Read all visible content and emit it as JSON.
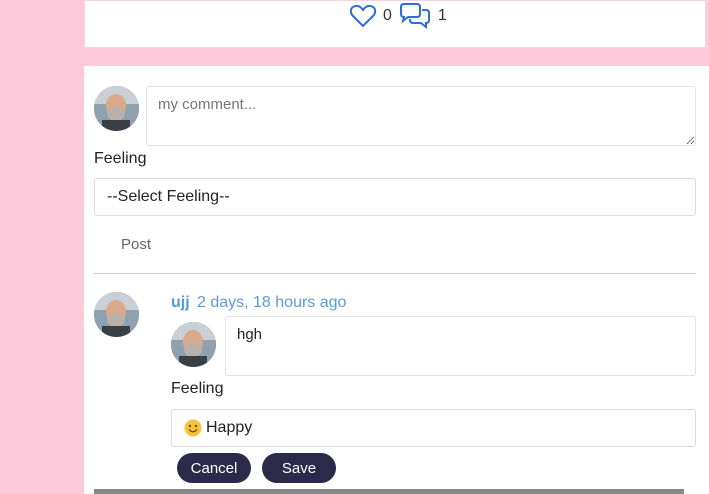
{
  "stats": {
    "likes": "0",
    "comments": "1"
  },
  "composer": {
    "placeholder": "my comment...",
    "feeling_label": "Feeling",
    "feeling_select": "--Select Feeling--",
    "post_label": "Post"
  },
  "comment": {
    "username": "ujj",
    "timestamp": "2 days, 18 hours ago",
    "reply_text": "hgh",
    "feeling_label": "Feeling",
    "feeling_value": "Happy",
    "cancel_label": "Cancel",
    "save_label": "Save"
  },
  "colors": {
    "background": "#ffc9dc",
    "accent": "#2c2a4a",
    "link": "#5b9bd5"
  }
}
